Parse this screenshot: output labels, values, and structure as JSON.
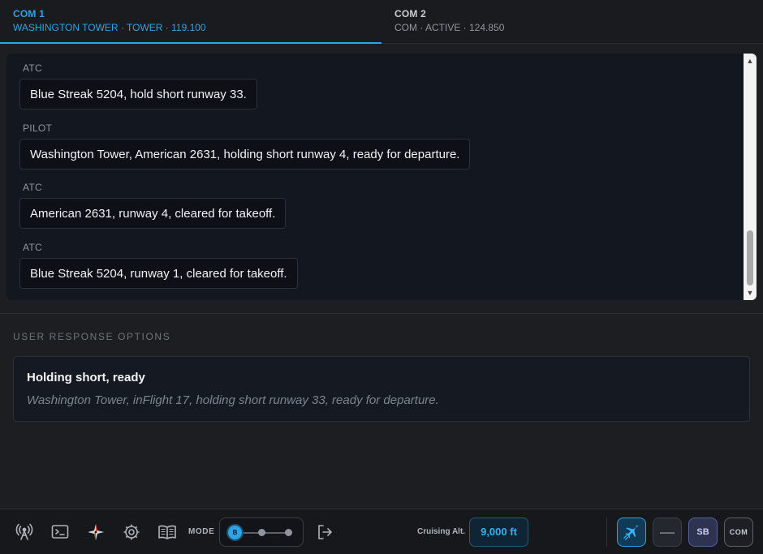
{
  "tabs": [
    {
      "title": "COM 1",
      "subtitle": "WASHINGTON TOWER · TOWER · 119.100",
      "active": true
    },
    {
      "title": "COM 2",
      "subtitle": "COM · ACTIVE · 124.850",
      "active": false
    }
  ],
  "transcript": [
    {
      "speaker": "ATC",
      "text": "Blue Streak 5204, hold short runway 33."
    },
    {
      "speaker": "PILOT",
      "text": "Washington Tower, American 2631, holding short runway 4, ready for departure."
    },
    {
      "speaker": "ATC",
      "text": "American 2631, runway 4, cleared for takeoff."
    },
    {
      "speaker": "ATC",
      "text": "Blue Streak 5204, runway 1, cleared for takeoff."
    }
  ],
  "responses": {
    "heading": "USER RESPONSE OPTIONS",
    "options": [
      {
        "title": "Holding short, ready",
        "text": "Washington Tower, inFlight 17, holding short runway 33, ready for departure."
      }
    ]
  },
  "toolbar": {
    "icons": [
      "radio-tower-icon",
      "terminal-icon",
      "compass-star-icon",
      "gear-icon",
      "book-icon"
    ],
    "mode_label": "MODE",
    "mode_knob": "B",
    "mode_position": 0,
    "mode_positions": 3,
    "exit_icon": "exit-icon",
    "cruise_label": "Cruising Alt.",
    "cruise_value": "9,000 ft",
    "buttons": {
      "flight": "plane-icon",
      "minus": "—",
      "sb": "SB",
      "com": "COM"
    }
  },
  "colors": {
    "accent": "#2ea3e6",
    "panel": "#131820",
    "background": "#1d1e21"
  }
}
